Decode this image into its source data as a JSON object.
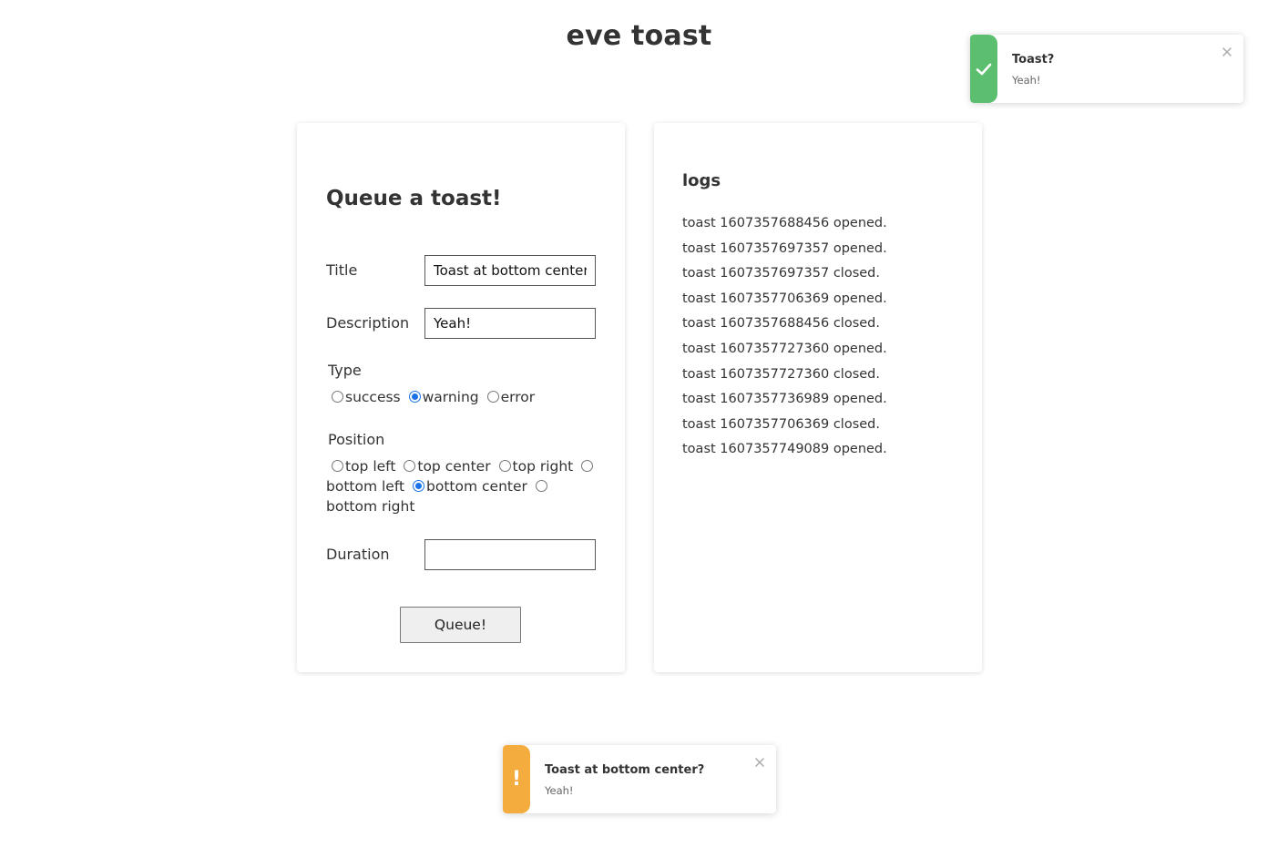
{
  "app": {
    "title": "eve toast"
  },
  "form": {
    "heading": "Queue a toast!",
    "title_label": "Title",
    "title_value": "Toast at bottom center?",
    "description_label": "Description",
    "description_value": "Yeah!",
    "type_label": "Type",
    "type_options": [
      {
        "label": "success",
        "checked": false
      },
      {
        "label": "warning",
        "checked": true
      },
      {
        "label": "error",
        "checked": false
      }
    ],
    "position_label": "Position",
    "position_options": [
      {
        "label": "top left",
        "checked": false
      },
      {
        "label": "top center",
        "checked": false
      },
      {
        "label": "top right",
        "checked": false
      },
      {
        "label": "bottom left",
        "checked": false
      },
      {
        "label": "bottom center",
        "checked": true
      },
      {
        "label": "bottom right",
        "checked": false
      }
    ],
    "duration_label": "Duration",
    "duration_value": "",
    "queue_button": "Queue!"
  },
  "logs": {
    "heading": "logs",
    "entries": [
      "toast 1607357688456 opened.",
      "toast 1607357697357 opened.",
      "toast 1607357697357 closed.",
      "toast 1607357706369 opened.",
      "toast 1607357688456 closed.",
      "toast 1607357727360 opened.",
      "toast 1607357727360 closed.",
      "toast 1607357736989 opened.",
      "toast 1607357706369 closed.",
      "toast 1607357749089 opened."
    ]
  },
  "toasts": {
    "top_right": {
      "type": "success",
      "icon": "check-icon",
      "color": "#5cbf6f",
      "title": "Toast?",
      "description": "Yeah!"
    },
    "bottom_center": {
      "type": "warning",
      "icon": "exclamation-icon",
      "color": "#f5ac3f",
      "title": "Toast at bottom center?",
      "description": "Yeah!"
    }
  }
}
